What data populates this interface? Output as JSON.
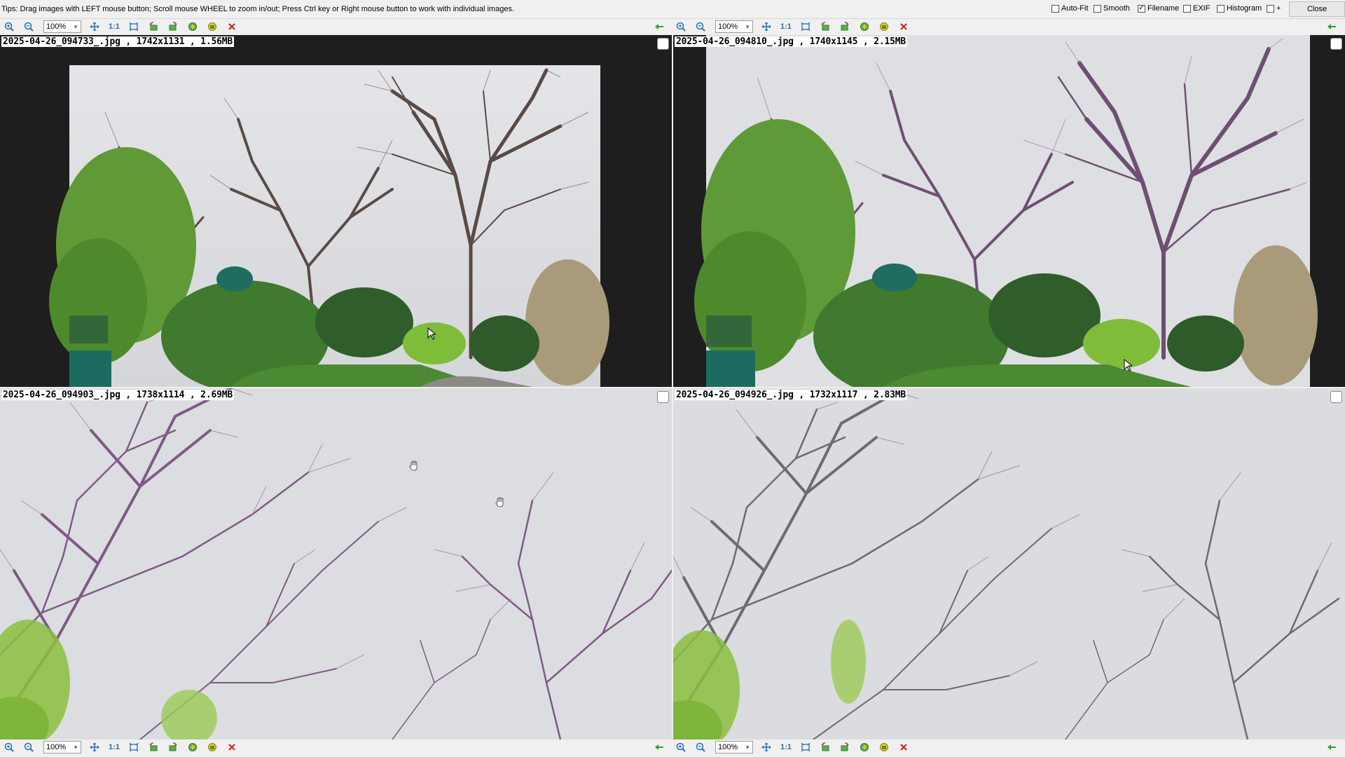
{
  "topbar": {
    "tips": "Tips: Drag images with LEFT mouse button; Scroll mouse WHEEL to zoom in/out; Press Ctrl key or Right mouse button to work with individual images.",
    "options": [
      {
        "label": "Auto-Fit",
        "checked": false
      },
      {
        "label": "Smooth",
        "checked": false
      },
      {
        "label": "Filename",
        "checked": true
      },
      {
        "label": "EXIF",
        "checked": false
      },
      {
        "label": "Histogram",
        "checked": false
      },
      {
        "label": "+",
        "checked": false
      }
    ],
    "close_label": "Close"
  },
  "toolbar": {
    "zoom_value": "100%",
    "actual_size_label": "1:1",
    "icons": [
      "zoom-in-icon",
      "zoom-out-icon",
      "fit-icon",
      "fit-window-icon",
      "rotate-left-icon",
      "rotate-right-icon",
      "compare-icon",
      "save-icon",
      "close-red-icon",
      "back-arrow-icon"
    ]
  },
  "panes": [
    {
      "filename": "2025-04-26_094733_.jpg , 1742x1131 , 1.56MB"
    },
    {
      "filename": "2025-04-26_094810_.jpg , 1740x1145 , 2.15MB"
    },
    {
      "filename": "2025-04-26_094903_.jpg , 1738x1114 , 2.69MB"
    },
    {
      "filename": "2025-04-26_094926_.jpg , 1732x1117 , 2.83MB"
    }
  ],
  "colors": {
    "sky": "#dcdde0",
    "foliage": "#3f7a2e",
    "branches_purple": "#7e5a86",
    "branches_gray": "#6e6a66",
    "viewer_background": "#1e1e1e",
    "close_red": "#d9261c",
    "toolbar_blue": "#2a6fb0",
    "toolbar_green": "#3a9a3a"
  }
}
